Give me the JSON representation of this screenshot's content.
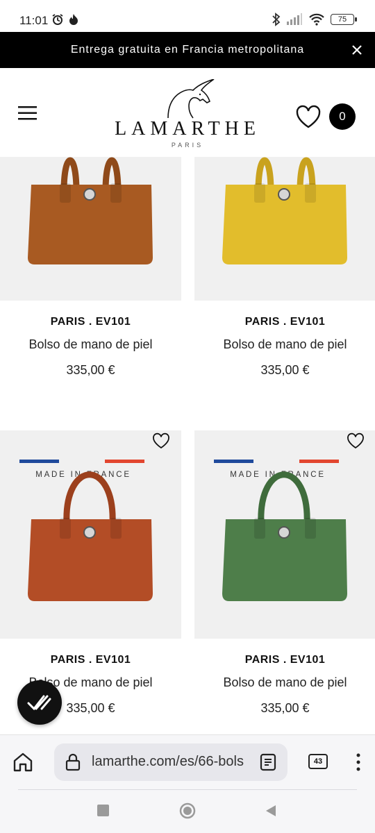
{
  "status_bar": {
    "time": "11:01",
    "battery": "75",
    "icons": [
      "alarm-icon",
      "flame-icon",
      "bluetooth-icon",
      "signal-icon",
      "wifi-icon",
      "battery-icon"
    ]
  },
  "promo": {
    "text": "Entrega gratuita en Francia metropolitana"
  },
  "header": {
    "logo_name": "LAMARTHE",
    "logo_sub": "PARIS",
    "cart_count": "0"
  },
  "products": [
    {
      "ref": "PARIS . EV101",
      "name": "Bolso de mano de piel",
      "price": "335,00 €",
      "color": "#a85a22"
    },
    {
      "ref": "PARIS . EV101",
      "name": "Bolso de mano de piel",
      "price": "335,00 €",
      "color": "#e2bd2c"
    },
    {
      "ref": "PARIS . EV101",
      "name": "Bolso de mano de piel",
      "price": "335,00 €",
      "color": "#b34d26",
      "badge": "MADE IN FRANCE"
    },
    {
      "ref": "PARIS . EV101",
      "name": "Bolso de mano de piel",
      "price": "335,00 €",
      "color": "#4e7e4a",
      "badge": "MADE IN FRANCE"
    }
  ],
  "browser": {
    "url": "lamarthe.com/es/66-bols",
    "tab_count": "43"
  },
  "colors": {
    "banner_bg": "#000000",
    "flag_blue": "#1f4a9c",
    "flag_red": "#e2462f",
    "image_bg": "#f0f0f0"
  }
}
